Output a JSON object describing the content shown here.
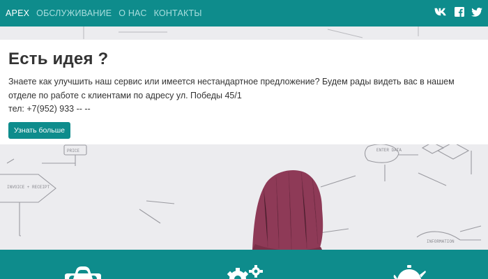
{
  "navbar": {
    "brand": "APEX",
    "links": [
      "ОБСЛУЖИВАНИЕ",
      "О НАС",
      "КОНТАКТЫ"
    ],
    "social_icons": [
      "vk-icon",
      "facebook-icon",
      "twitter-icon"
    ]
  },
  "jumbotron": {
    "title": "Есть идея ?",
    "text": "Знаете как улучшить наш сервис или имеется нестандартное предложение? Будем рады видеть вас в нашем отделе по работе с клиентами по адресу ул. Победы 45/1",
    "phone": "тел: +7(952) 933 -- --",
    "button_label": "Узнать больше"
  },
  "hero_image": {
    "sketch_labels": [
      "PRICE",
      "ENTER DATA",
      "INVOICE + RECEIPT",
      "INFORMATION"
    ]
  },
  "features": {
    "icons": [
      "car-icon",
      "gears-icon",
      "teapot-icon"
    ]
  },
  "colors": {
    "primary": "#0e8c8c",
    "nav_link": "#a9dede",
    "hat": "#8e3a57",
    "text": "#333333"
  }
}
